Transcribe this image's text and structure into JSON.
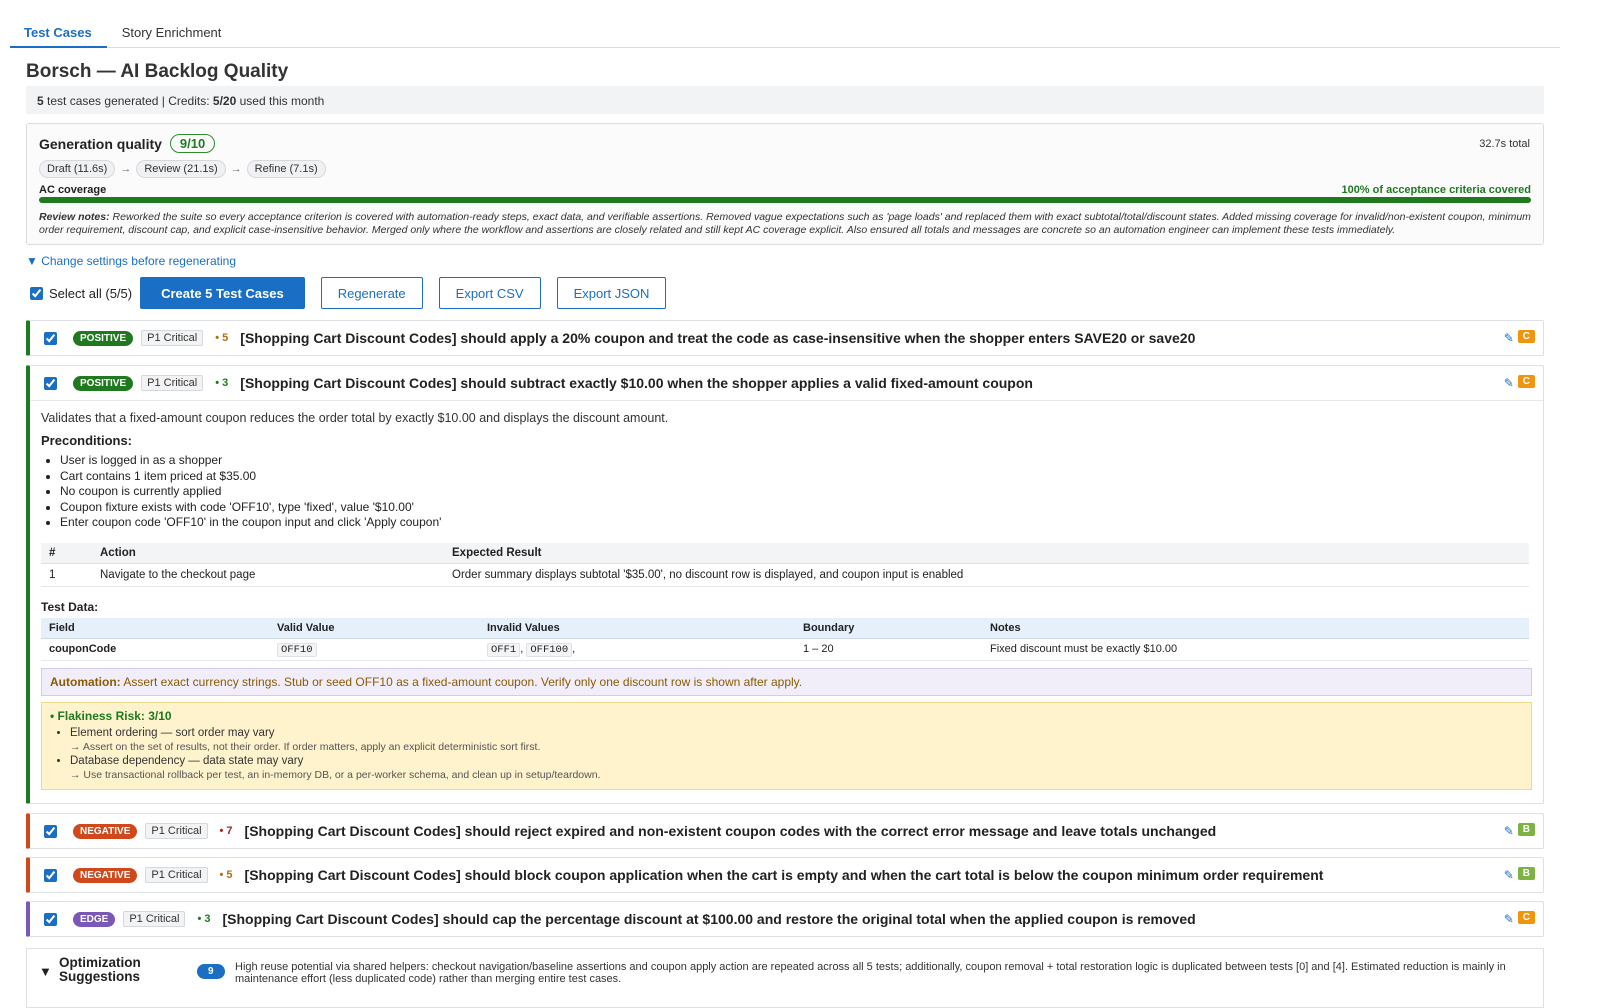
{
  "tabs": [
    {
      "label": "Test Cases",
      "active": true
    },
    {
      "label": "Story Enrichment",
      "active": false
    }
  ],
  "page_title": "Borsch — AI Backlog Quality",
  "summary": {
    "count": "5",
    "generated_text": "test cases generated | Credits:",
    "credits": "5/20",
    "credits_suffix": "used this month"
  },
  "generation": {
    "title": "Generation quality",
    "score": "9/10",
    "total_time": "32.7s total",
    "stages": [
      "Draft (11.6s)",
      "Review (21.1s)",
      "Refine (7.1s)"
    ],
    "arrow": "→",
    "ac_label": "AC coverage",
    "ac_value": "100% of acceptance criteria covered",
    "ac_percent": 100,
    "review_label": "Review notes:",
    "review_text": "Reworked the suite so every acceptance criterion is covered with automation-ready steps, exact data, and verifiable assertions. Removed vague expectations such as 'page loads' and replaced them with exact subtotal/total/discount states. Added missing coverage for invalid/non-existent coupon, minimum order requirement, discount cap, and explicit case-insensitive behavior. Merged only where the workflow and assertions are closely related and still kept AC coverage explicit. Also ensured all totals and messages are concrete so an automation engineer can implement these tests immediately."
  },
  "settings_link": "▼ Change settings before regenerating",
  "actions": {
    "select_all": "Select all (5/5)",
    "create": "Create 5 Test Cases",
    "regenerate": "Regenerate",
    "export_csv": "Export CSV",
    "export_json": "Export JSON"
  },
  "test_cases": [
    {
      "type": "POSITIVE",
      "priority": "P1 Critical",
      "score": "• 5",
      "title": "[Shopping Cart Discount Codes] should apply a 20% coupon and treat the code as case-insensitive when the shopper enters SAVE20 or save20",
      "grade": "C"
    },
    {
      "type": "POSITIVE",
      "priority": "P1 Critical",
      "score": "• 3",
      "title": "[Shopping Cart Discount Codes] should subtract exactly $10.00 when the shopper applies a valid fixed-amount coupon",
      "grade": "C"
    },
    {
      "type": "NEGATIVE",
      "priority": "P1 Critical",
      "score": "• 7",
      "title": "[Shopping Cart Discount Codes] should reject expired and non-existent coupon codes with the correct error message and leave totals unchanged",
      "grade": "B"
    },
    {
      "type": "NEGATIVE",
      "priority": "P1 Critical",
      "score": "• 5",
      "title": "[Shopping Cart Discount Codes] should block coupon application when the cart is empty and when the cart total is below the coupon minimum order requirement",
      "grade": "B"
    },
    {
      "type": "EDGE",
      "priority": "P1 Critical",
      "score": "• 3",
      "title": "[Shopping Cart Discount Codes] should cap the percentage discount at $100.00 and restore the original total when the applied coupon is removed",
      "grade": "C"
    }
  ],
  "detail": {
    "description": "Validates that a fixed-amount coupon reduces the order total by exactly $10.00 and displays the discount amount.",
    "preconditions_label": "Preconditions:",
    "preconditions": [
      "User is logged in as a shopper",
      "Cart contains 1 item priced at $35.00",
      "No coupon is currently applied",
      "Coupon fixture exists with code 'OFF10', type 'fixed', value '$10.00'",
      "Enter coupon code 'OFF10' in the coupon input and click 'Apply coupon'"
    ],
    "steps_headers": [
      "#",
      "Action",
      "Expected Result"
    ],
    "steps": [
      {
        "n": "1",
        "action": "Navigate to the checkout page",
        "expected": "Order summary displays subtotal '$35.00', no discount row is displayed, and coupon input is enabled"
      }
    ],
    "test_data_label": "Test Data:",
    "test_data_headers": [
      "Field",
      "Valid Value",
      "Invalid Values",
      "Boundary",
      "Notes"
    ],
    "test_data": {
      "field": "couponCode",
      "valid": "OFF10",
      "invalid_1": "OFF1",
      "invalid_sep": ",",
      "invalid_2": "OFF100",
      "boundary": "1 – 20",
      "notes": "Fixed discount must be exactly $10.00"
    },
    "automation_label": "Automation:",
    "automation_text": "Assert exact currency strings. Stub or seed OFF10 as a fixed-amount coupon. Verify only one discount row is shown after apply.",
    "flakiness_title": "• Flakiness Risk: 3/10",
    "flakiness_items": [
      {
        "risk": "Element ordering — sort order may vary",
        "advice": "→ Assert on the set of results, not their order. If order matters, apply an explicit deterministic sort first."
      },
      {
        "risk": "Database dependency — data state may vary",
        "advice": "→ Use transactional rollback per test, an in-memory DB, or a per-worker schema, and clean up in setup/teardown."
      }
    ]
  },
  "optimization": {
    "toggle": "▼",
    "title": "Optimization Suggestions",
    "count": "9",
    "text": "High reuse potential via shared helpers: checkout navigation/baseline assertions and coupon apply action are repeated across all 5 tests; additionally, coupon removal + total restoration logic is duplicated between tests [0] and [4]. Estimated reduction is mainly in maintenance effort (less duplicated code) rather than merging entire test cases."
  },
  "colors": {
    "accent": "#1a6fc4",
    "positive": "#1f7a1f",
    "negative": "#d0491c",
    "edge": "#7b57b8",
    "grade_c": "#f0950e",
    "grade_b": "#7cb342"
  },
  "icons": {
    "edit": "pencil-icon",
    "toggle": "triangle-down-icon"
  }
}
